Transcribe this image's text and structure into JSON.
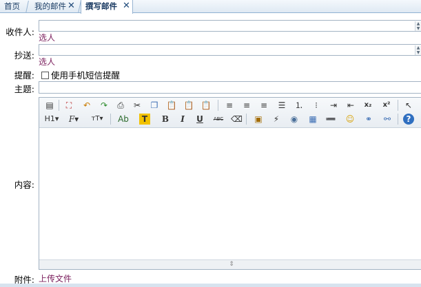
{
  "tabs": [
    {
      "label": "首页",
      "closable": false,
      "active": false
    },
    {
      "label": "我的邮件",
      "closable": true,
      "active": false
    },
    {
      "label": "撰写邮件",
      "closable": true,
      "active": true
    }
  ],
  "tab_close_glyph": "✕",
  "form": {
    "recipient_label": "收件人:",
    "recipient_pick": "选人",
    "cc_label": "抄送:",
    "cc_pick": "选人",
    "remind_label": "提醒:",
    "sms_remind_text": "使用手机短信提醒",
    "subject_label": "主题:",
    "content_label": "内容:",
    "attachment_label": "附件:",
    "upload_link": "上传文件"
  },
  "toolbar": {
    "row1": [
      "source-icon",
      "fullscreen-icon",
      "undo-icon",
      "redo-icon",
      "print-icon",
      "cut-icon",
      "copy-icon",
      "paste-icon",
      "paste-text-icon",
      "paste-word-icon",
      "align-left-icon",
      "align-center-icon",
      "align-right-icon",
      "justify-icon",
      "ordered-list-icon",
      "unordered-list-icon",
      "indent-icon",
      "outdent-icon",
      "subscript-icon",
      "superscript-icon",
      "select-all-icon"
    ],
    "row1_glyphs": {
      "subscript": "x₂",
      "superscript": "x²"
    },
    "row2_labels": {
      "heading": "H1",
      "font": "F",
      "font_size": "тT",
      "font_color": "Ab",
      "highlight": "T",
      "bold": "B",
      "italic": "I",
      "underline": "U",
      "strikethrough": "ABC"
    },
    "row2_icons": [
      "eraser-icon",
      "image-icon",
      "flash-icon",
      "media-icon",
      "table-icon",
      "horizontal-rule-icon",
      "emoticon-icon",
      "link-icon",
      "unlink-icon",
      "help-icon"
    ]
  }
}
